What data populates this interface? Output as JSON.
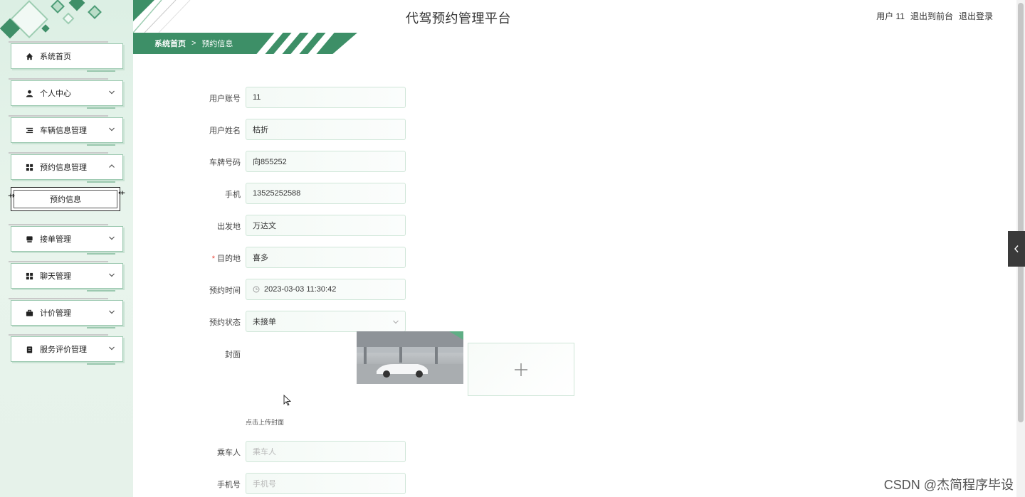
{
  "app": {
    "title": "代驾预约管理平台",
    "user_label": "用户 11",
    "front_link": "退出到前台",
    "logout_link": "退出登录"
  },
  "breadcrumb": {
    "home": "系统首页",
    "separator": ">",
    "current": "预约信息"
  },
  "sidebar": {
    "items": [
      {
        "label": "系统首页",
        "icon": "home-icon"
      },
      {
        "label": "个人中心",
        "icon": "user-icon"
      },
      {
        "label": "车辆信息管理",
        "icon": "list-icon"
      },
      {
        "label": "预约信息管理",
        "icon": "grid-icon"
      },
      {
        "label": "接单管理",
        "icon": "archive-icon"
      },
      {
        "label": "聊天管理",
        "icon": "grid-icon"
      },
      {
        "label": "计价管理",
        "icon": "briefcase-icon"
      },
      {
        "label": "服务评价管理",
        "icon": "clipboard-icon"
      }
    ],
    "active_sub": "预约信息"
  },
  "form": {
    "account": {
      "label": "用户账号",
      "value": "11"
    },
    "name": {
      "label": "用户姓名",
      "value": "枯折"
    },
    "plate": {
      "label": "车牌号码",
      "value": "向855252"
    },
    "phone": {
      "label": "手机",
      "value": "13525252588"
    },
    "origin": {
      "label": "出发地",
      "value": "万达文"
    },
    "destination": {
      "label": "目的地",
      "value": "喜多",
      "required_mark": "*"
    },
    "time": {
      "label": "预约时间",
      "value": "2023-03-03 11:30:42"
    },
    "status": {
      "label": "预约状态",
      "value": "未接单"
    },
    "cover": {
      "label": "封面",
      "hint": "点击上传封面"
    },
    "passenger": {
      "label": "乘车人",
      "placeholder": "乘车人"
    },
    "mobile": {
      "label": "手机号",
      "placeholder": "手机号"
    }
  },
  "watermark": "CSDN @杰简程序毕设",
  "colors": {
    "brand_green": "#3d8f67",
    "sidebar_bg": "#dcefe4",
    "border_green": "#9cc9b0"
  }
}
